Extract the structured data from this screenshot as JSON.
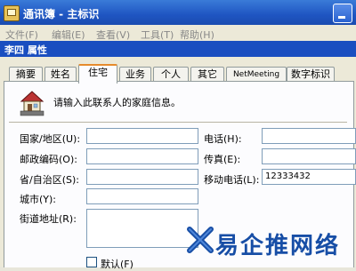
{
  "main_window": {
    "title": "通讯簿 - 主标识",
    "menu": [
      "文件(F)",
      "编辑(E)",
      "查看(V)",
      "工具(T)",
      "帮助(H)"
    ]
  },
  "dialog": {
    "title": "李四 属性",
    "tabs": [
      "摘要",
      "姓名",
      "住宅",
      "业务",
      "个人",
      "其它",
      "NetMeeting",
      "数字标识"
    ],
    "active_tab": "住宅",
    "intro": "请输入此联系人的家庭信息。",
    "labels": {
      "country": "国家/地区(U):",
      "postal": "邮政编码(O):",
      "province": "省/自治区(S):",
      "city": "城市(Y):",
      "street": "街道地址(R):",
      "phone": "电话(H):",
      "fax": "传真(E):",
      "mobile": "移动电话(L):",
      "default": "默认(F)"
    },
    "values": {
      "country": "",
      "postal": "",
      "province": "",
      "city": "",
      "street": "",
      "phone": "",
      "fax": "",
      "mobile": "12333432"
    }
  },
  "watermark": "易企推网络",
  "colors": {
    "title_bar": "#1a4ec0",
    "dialog_bg": "#ece9d8",
    "active_tab_accent": "#e68b2c",
    "watermark": "#174ea6"
  }
}
